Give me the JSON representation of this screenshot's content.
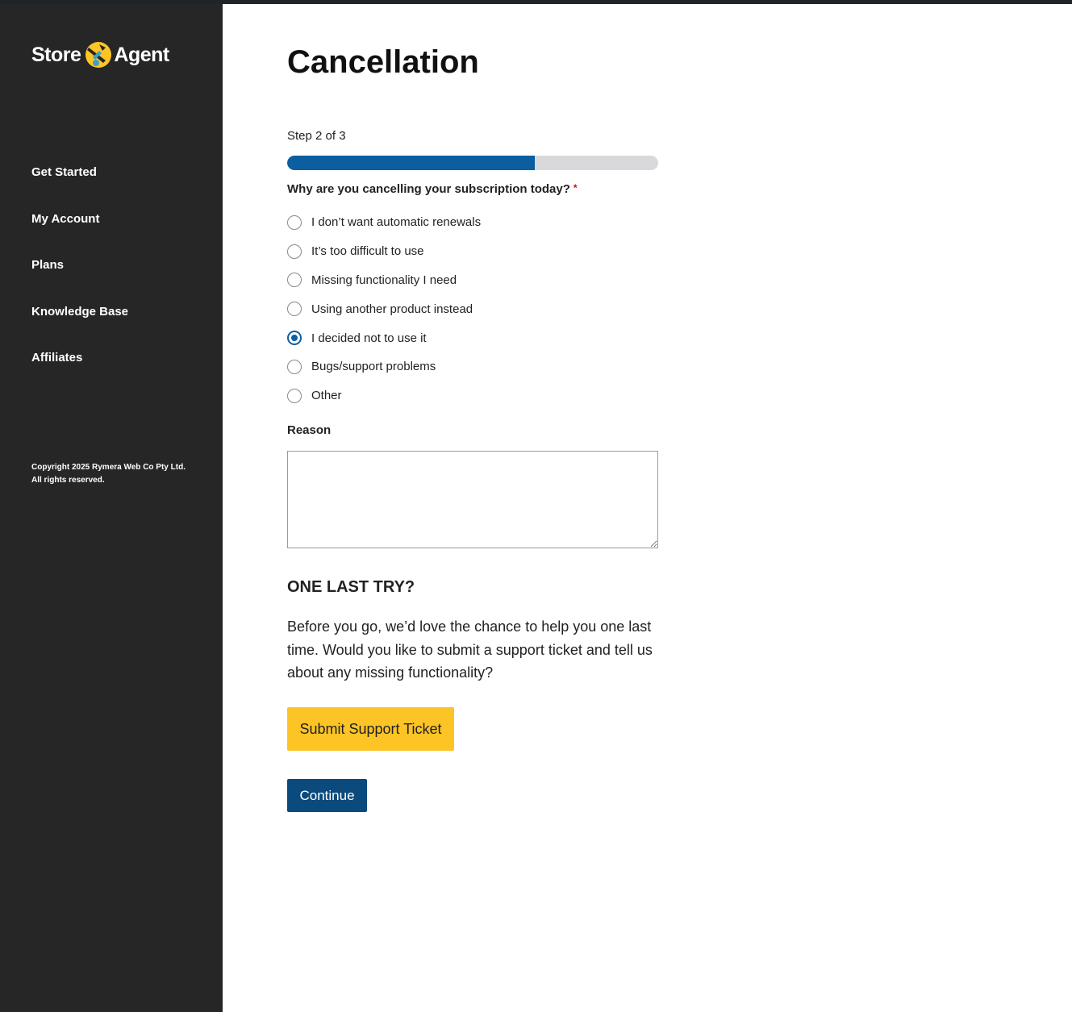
{
  "brand": {
    "name_left": "Store",
    "name_right": "Agent",
    "accent_color": "#fdc425"
  },
  "sidebar": {
    "background": "#262626",
    "items": [
      {
        "label": "Get Started"
      },
      {
        "label": "My Account"
      },
      {
        "label": "Plans"
      },
      {
        "label": "Knowledge Base"
      },
      {
        "label": "Affiliates"
      }
    ],
    "copyright_line1": "Copyright 2025 Rymera Web Co Pty Ltd.",
    "copyright_line2": "All rights reserved."
  },
  "main": {
    "title": "Cancellation",
    "step_label": "Step 2 of 3",
    "progress": {
      "current": 2,
      "total": 3,
      "fill_color": "#0b5ea0"
    },
    "question": "Why are you cancelling your subscription today?",
    "required_mark": "*",
    "options": [
      {
        "label": "I don’t want automatic renewals",
        "checked": false
      },
      {
        "label": "It’s too difficult to use",
        "checked": false
      },
      {
        "label": "Missing functionality I need",
        "checked": false
      },
      {
        "label": "Using another product instead",
        "checked": false
      },
      {
        "label": "I decided not to use it",
        "checked": true
      },
      {
        "label": "Bugs/support problems",
        "checked": false
      },
      {
        "label": "Other",
        "checked": false
      }
    ],
    "reason_label": "Reason",
    "reason_value": "",
    "one_last_try": {
      "heading": "ONE LAST TRY?",
      "text": "Before you go, we’d love the chance to help you one last time. Would you like to submit a support ticket and tell us about any missing functionality?",
      "button_label": "Submit Support Ticket"
    },
    "continue_label": "Continue"
  }
}
